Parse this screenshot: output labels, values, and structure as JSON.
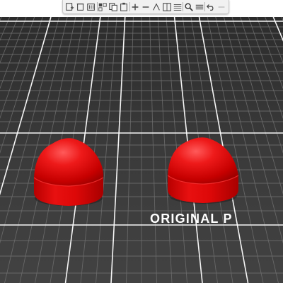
{
  "toolbar": {
    "items": [
      {
        "icon": "add-icon"
      },
      {
        "icon": "delete-icon"
      },
      {
        "icon": "delete-all-icon"
      },
      {
        "icon": "arrange-icon"
      },
      {
        "icon": "copy-icon"
      },
      {
        "icon": "paste-icon"
      },
      {
        "icon": "add-instance-icon"
      },
      {
        "icon": "remove-instance-icon"
      },
      {
        "icon": "split-to-objects-icon"
      },
      {
        "icon": "split-to-parts-icon"
      },
      {
        "icon": "variable-layer-height-icon"
      },
      {
        "icon": "search-icon"
      },
      {
        "icon": "layers-editing-icon"
      },
      {
        "icon": "undo-icon"
      },
      {
        "icon": "redo-icon"
      }
    ]
  },
  "bed": {
    "label": "ORIGINAL P",
    "color": "#3c3c3c",
    "grid_color": "#6e6e6e",
    "major_grid_color": "#ffffff"
  },
  "objects": [
    {
      "name": "left-dome-part",
      "color": "#e01010"
    },
    {
      "name": "right-dome-part",
      "color": "#e01010"
    }
  ]
}
